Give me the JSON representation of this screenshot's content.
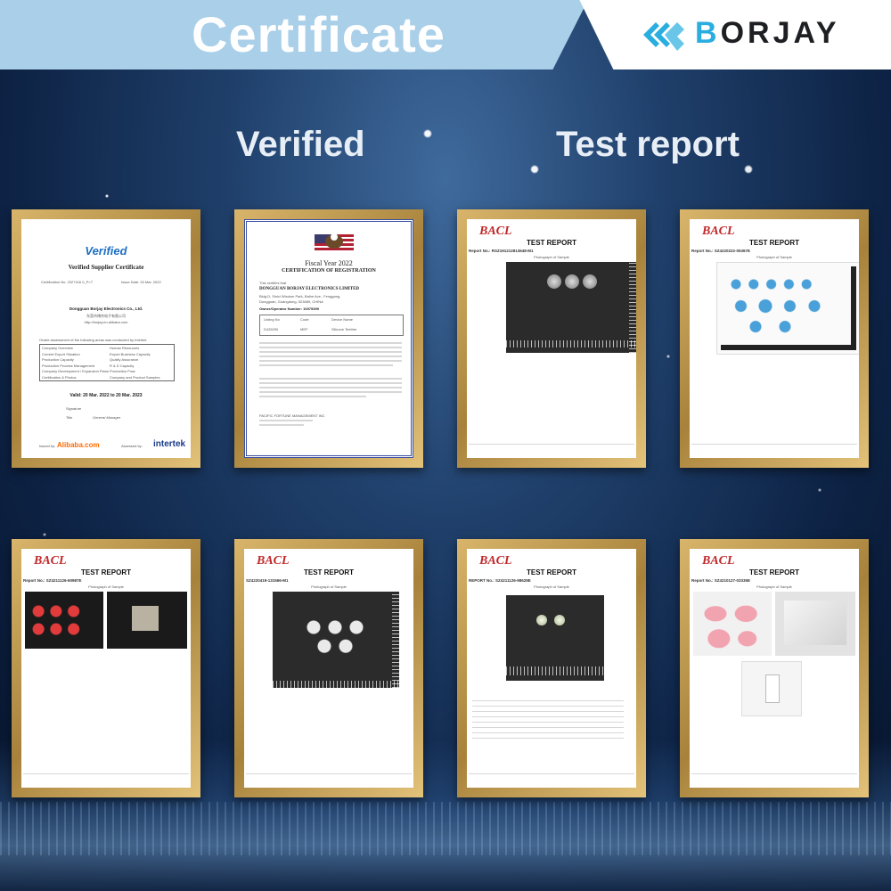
{
  "header": {
    "title": "Certificate",
    "logo_prefix": "B",
    "logo_rest": "ORJAY"
  },
  "sections": {
    "verified": "Verified",
    "test_report": "Test report"
  },
  "documents": {
    "verified_cert": {
      "brand": "Verified",
      "title": "Verified Supplier Certificate",
      "certification_no": "Certification No. 2327416 0_P=T",
      "issue_date": "Issue Date: 20 Mar. 2022",
      "company": "Dongguan Borjay Electronics Co., Ltd.",
      "company_cn": "东莞市博杰电子有限公司",
      "website": "http://borjay.en.alibaba.com",
      "assessment": "Onsite assessment of the following areas was conducted by Intertek",
      "areas_left": [
        "Company Overview",
        "Current Export Situation",
        "Production Capacity",
        "Production Process Management",
        "Company Development / Expansion Plans",
        "Certification & Photos"
      ],
      "areas_right": [
        "Human Resources",
        "Export Business Capacity",
        "Quality Assurance",
        "R & D Capacity",
        "Production Flow",
        "Company and Product Samples"
      ],
      "valid": "Valid: 20 Mar. 2022 to 20 Mar. 2023",
      "signature_label": "Signature",
      "title_label": "Title",
      "title_value": "General Manager",
      "issued_by": "Issued by:",
      "alibaba": "Alibaba.com",
      "assessed_by": "Assessed by:",
      "intertek": "intertek"
    },
    "fda_cert": {
      "fiscal": "Fiscal Year 2022",
      "title": "CERTIFICATION OF REGISTRATION",
      "certify": "This certifies that",
      "company": "DONGGUAN BORJAY ELECTRONICS LIMITED",
      "address1": "Bldg.D, Sinici Wisdom Park, Baihe Ave., Fenggang,",
      "address2": "Dongguan, Guangdong, 523689, CHINA",
      "owner": "Owner/Operator Number: 10079399",
      "col1": "Listing No",
      "col2": "Code",
      "col3": "Device Name",
      "row1": "D428290",
      "row2": "MEF",
      "row3": "Silicone Teether",
      "issuer": "PACIFIC FORTUNE MANAGEMENT INC"
    },
    "reports": [
      {
        "lab": "BACL",
        "title": "TEST REPORT",
        "no": "Report No.: RSZ191212813648-M1",
        "caption": "Photograph of Sample"
      },
      {
        "lab": "BACL",
        "title": "TEST REPORT",
        "no": "Report No.: SZ4220222-05367E",
        "caption": "Photograph of Sample"
      },
      {
        "lab": "BACL",
        "title": "TEST REPORT",
        "no": "Report No.: SZ4211126-60987E",
        "caption": "Photograph of Sample"
      },
      {
        "lab": "BACL",
        "title": "TEST REPORT",
        "no": "SZ4220419-131566-M1",
        "caption": "Photograph of Sample"
      },
      {
        "lab": "BACL",
        "title": "TEST REPORT",
        "no": "REPORT No.: SZ4211126-98628E",
        "caption": "Photograph of Sample"
      },
      {
        "lab": "BACL",
        "title": "TEST REPORT",
        "no": "Report No.: SZ4210127-03335E",
        "caption": "Photograph of Sample"
      }
    ]
  }
}
